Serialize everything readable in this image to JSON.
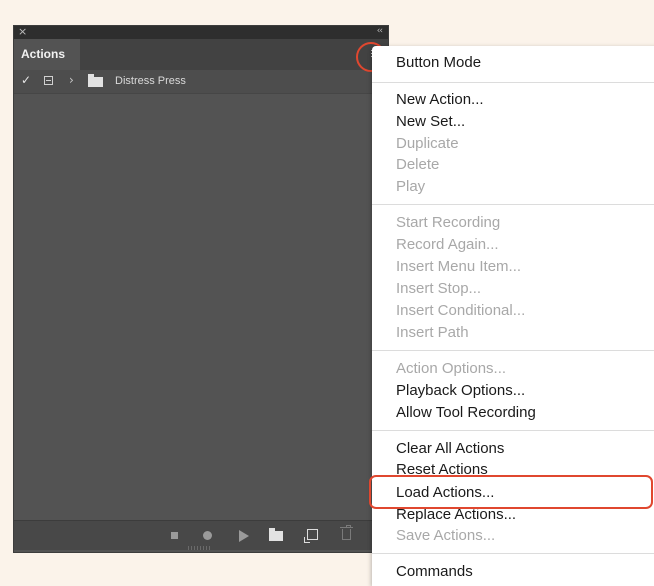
{
  "panel": {
    "close_glyph": "×",
    "collapse_glyph": "‹‹",
    "tab_label": "Actions",
    "row": {
      "check_glyph": "✓",
      "chevron_glyph": "›",
      "set_name": "Distress Press"
    }
  },
  "flyout": {
    "items": [
      {
        "label": "Button Mode",
        "enabled": true
      },
      {
        "label": "New Action...",
        "enabled": true
      },
      {
        "label": "New Set...",
        "enabled": true
      },
      {
        "label": "Duplicate",
        "enabled": false
      },
      {
        "label": "Delete",
        "enabled": false
      },
      {
        "label": "Play",
        "enabled": false
      },
      {
        "label": "Start Recording",
        "enabled": false
      },
      {
        "label": "Record Again...",
        "enabled": false
      },
      {
        "label": "Insert Menu Item...",
        "enabled": false
      },
      {
        "label": "Insert Stop...",
        "enabled": false
      },
      {
        "label": "Insert Conditional...",
        "enabled": false
      },
      {
        "label": "Insert Path",
        "enabled": false
      },
      {
        "label": "Action Options...",
        "enabled": false
      },
      {
        "label": "Playback Options...",
        "enabled": true
      },
      {
        "label": "Allow Tool Recording",
        "enabled": true
      },
      {
        "label": "Clear All Actions",
        "enabled": true
      },
      {
        "label": "Reset Actions",
        "enabled": true
      },
      {
        "label": "Load Actions...",
        "enabled": true
      },
      {
        "label": "Replace Actions...",
        "enabled": true
      },
      {
        "label": "Save Actions...",
        "enabled": false
      },
      {
        "label": "Commands",
        "enabled": true
      }
    ]
  },
  "colors": {
    "highlight": "#e0472f",
    "panel_bg": "#535353",
    "page_bg": "#fbf3ea"
  }
}
